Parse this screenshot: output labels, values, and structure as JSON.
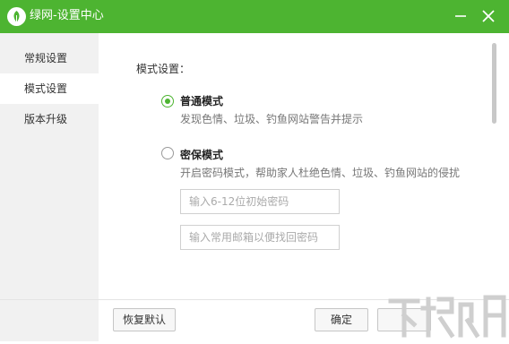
{
  "window": {
    "title": "绿网-设置中心",
    "minimize_icon": "minimize-icon",
    "close_icon": "close-icon"
  },
  "sidebar": {
    "items": [
      {
        "label": "常规设置",
        "active": false
      },
      {
        "label": "模式设置",
        "active": true
      },
      {
        "label": "版本升级",
        "active": false
      }
    ]
  },
  "main": {
    "section_label": "模式设置：",
    "options": [
      {
        "title": "普通模式",
        "desc": "发现色情、垃圾、钓鱼网站警告并提示",
        "checked": true
      },
      {
        "title": "密保模式",
        "desc": "开启密码模式，帮助家人杜绝色情、垃圾、钓鱼网站的侵扰",
        "checked": false
      }
    ],
    "password_field": {
      "placeholder": "输入6-12位初始密码",
      "value": ""
    },
    "email_field": {
      "placeholder": "输入常用邮箱以便找回密码",
      "value": ""
    }
  },
  "footer": {
    "restore_label": "恢复默认",
    "ok_label": "确定",
    "cancel_label": ""
  },
  "colors": {
    "accent": "#4db431",
    "sidebar_bg": "#f1f1f1"
  }
}
